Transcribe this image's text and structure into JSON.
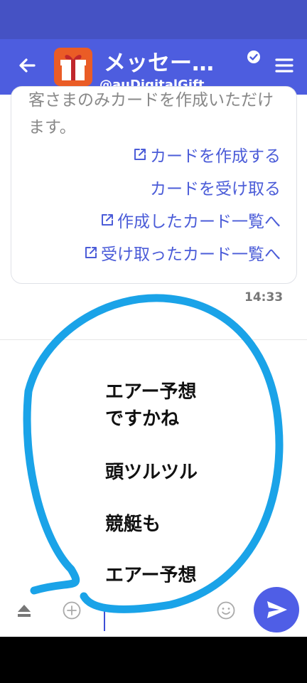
{
  "header": {
    "back_icon": "back-arrow-icon",
    "app_icon": "gift-box-icon",
    "title": "メッセー…",
    "verified_icon": "verified-badge-icon",
    "account_id": "@auDigitalGift",
    "menu_icon": "menu-icon"
  },
  "card": {
    "description": "客さまのみカードを作成いただけます。",
    "links": [
      {
        "label": "カードを作成する",
        "external": true
      },
      {
        "label": "カードを受け取る",
        "external": false
      },
      {
        "label": "作成したカード一覧へ",
        "external": true
      },
      {
        "label": "受け取ったカード一覧へ",
        "external": true
      }
    ],
    "time": "14:33"
  },
  "suggestions": [
    "エアー予想",
    "ですかね",
    "頭ツルツル",
    "競艇も",
    "エアー予想"
  ],
  "input_bar": {
    "collapse_icon": "eject-icon",
    "add_icon": "plus-circle-icon",
    "text_value": "",
    "emoji_icon": "smiley-icon",
    "send_icon": "send-icon"
  },
  "colors": {
    "header": "#4d5ddf",
    "status_bar": "#4552c4",
    "link": "#4b5cd8",
    "annotation": "#1aa3e8",
    "send": "#4f5ee6"
  }
}
